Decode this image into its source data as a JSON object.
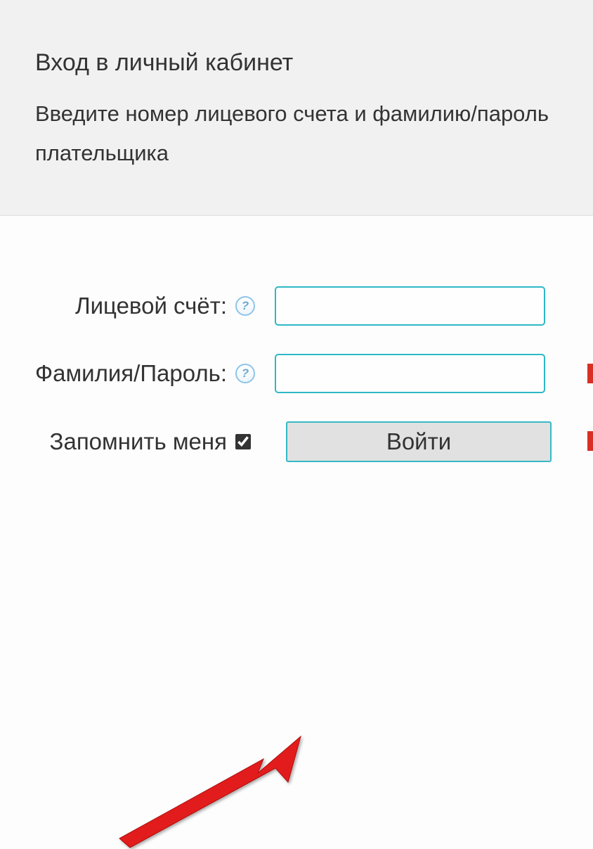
{
  "header": {
    "title": "Вход в личный кабинет",
    "subtitle": "Введите номер лицевого счета и фамилию/пароль плательщика"
  },
  "form": {
    "account_label": "Лицевой счёт:",
    "password_label": "Фамилия/Пароль:",
    "remember_label": "Запомнить меня",
    "submit_label": "Войти",
    "help_icon_text": "?",
    "account_value": "",
    "password_value": "",
    "remember_checked": true
  }
}
